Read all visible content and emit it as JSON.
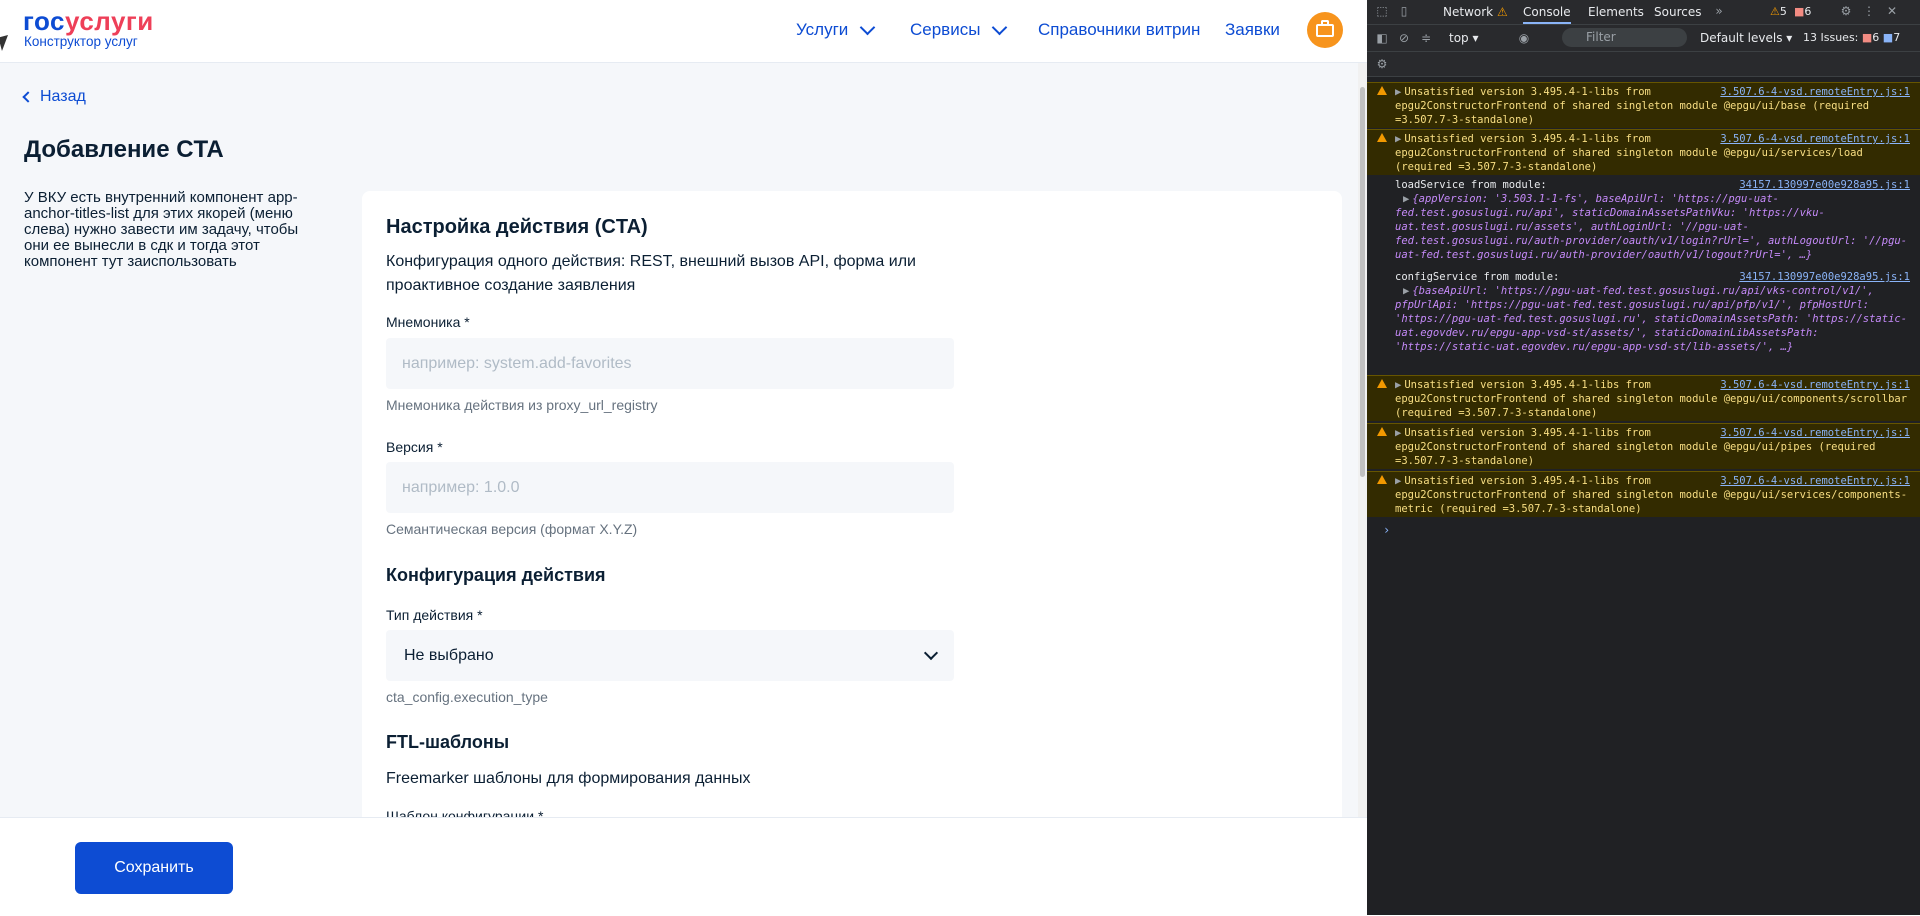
{
  "header": {
    "logo_part1": "гос",
    "logo_part2": "услуги",
    "logo_sub": "Конструктор услуг",
    "nav": [
      {
        "label": "Услуги",
        "has_dropdown": true
      },
      {
        "label": "Сервисы",
        "has_dropdown": true
      },
      {
        "label": "Справочники витрин",
        "has_dropdown": false
      },
      {
        "label": "Заявки",
        "has_dropdown": false
      }
    ],
    "avatar_color": "#f7941d"
  },
  "page": {
    "back_label": "Назад",
    "title": "Добавление CTA",
    "side_note": "У ВКУ есть внутренний компонент app-anchor-titles-list для этих якорей (меню слева) нужно завести им задачу, чтобы они ее вынесли в сдк и тогда этот компонент тут заиспользовать"
  },
  "form": {
    "section1_title": "Настройка действия (CTA)",
    "section1_desc": "Конфигурация одного действия: REST, внешний вызов API, форма или проактивное создание заявления",
    "mnemonic_label": "Мнемоника *",
    "mnemonic_placeholder": "например: system.add-favorites",
    "mnemonic_hint": "Мнемоника действия из proxy_url_registry",
    "version_label": "Версия *",
    "version_placeholder": "например: 1.0.0",
    "version_hint": "Семантическая версия (формат X.Y.Z)",
    "section2_title": "Конфигурация действия",
    "action_type_label": "Тип действия *",
    "action_type_value": "Не выбрано",
    "action_type_hint": "cta_config.execution_type",
    "section3_title": "FTL-шаблоны",
    "section3_desc": "Freemarker шаблоны для формирования данных",
    "template_label": "Шаблон конфигурации *"
  },
  "footer": {
    "save_label": "Сохранить"
  },
  "devtools": {
    "tabs": [
      "Network",
      "Console",
      "Elements",
      "Sources"
    ],
    "active_tab": "Console",
    "warn_count": "5",
    "error_count": "6",
    "context": "top",
    "filter_placeholder": "Filter",
    "levels": "Default levels",
    "issues_label": "13 Issues:",
    "issues_err": "6",
    "issues_info": "7",
    "messages": [
      {
        "type": "warn",
        "text": "Unsatisfied version 3.495.4-1-libs from epgu2ConstructorFrontend of shared singleton module @epgu/ui/base (required =3.507.7-3-standalone)",
        "source": "3.507.6-4-vsd.remoteEntry.js:1"
      },
      {
        "type": "warn",
        "text": "Unsatisfied version 3.495.4-1-libs from epgu2ConstructorFrontend of shared singleton module @epgu/ui/services/load (required =3.507.7-3-standalone)",
        "source": "3.507.6-4-vsd.remoteEntry.js:1"
      },
      {
        "type": "log",
        "text": "loadService from module:",
        "source": "34157.130997e00e928a95.js:1",
        "object": "{appVersion: '3.503.1-1-fs', baseApiUrl: 'https://pgu-uat-fed.test.gosuslugi.ru/api', staticDomainAssetsPathVku: 'https://vku-uat.test.gosuslugi.ru/assets', authLoginUrl: '//pgu-uat-fed.test.gosuslugi.ru/auth-provider/oauth/v1/login?rUrl=', authLogoutUrl: '//pgu-uat-fed.test.gosuslugi.ru/auth-provider/oauth/v1/logout?rUrl=', …}"
      },
      {
        "type": "log",
        "text": "configService from module:",
        "source": "34157.130997e00e928a95.js:1",
        "object": "{baseApiUrl: 'https://pgu-uat-fed.test.gosuslugi.ru/api/vks-control/v1/', pfpUrlApi: 'https://pgu-uat-fed.test.gosuslugi.ru/api/pfp/v1/', pfpHostUrl: 'https://pgu-uat-fed.test.gosuslugi.ru', staticDomainAssetsPath: 'https://static-uat.egovdev.ru/epgu-app-vsd-st/assets/', staticDomainLibAssetsPath: 'https://static-uat.egovdev.ru/epgu-app-vsd-st/lib-assets/', …}"
      },
      {
        "type": "warn",
        "text": "Unsatisfied version 3.495.4-1-libs from epgu2ConstructorFrontend of shared singleton module @epgu/ui/components/scrollbar (required =3.507.7-3-standalone)",
        "source": "3.507.6-4-vsd.remoteEntry.js:1"
      },
      {
        "type": "warn",
        "text": "Unsatisfied version 3.495.4-1-libs from epgu2ConstructorFrontend of shared singleton module @epgu/ui/pipes (required =3.507.7-3-standalone)",
        "source": "3.507.6-4-vsd.remoteEntry.js:1"
      },
      {
        "type": "warn",
        "text": "Unsatisfied version 3.495.4-1-libs from epgu2ConstructorFrontend of shared singleton module @epgu/ui/services/components-metric (required =3.507.7-3-standalone)",
        "source": "3.507.6-4-vsd.remoteEntry.js:1"
      }
    ]
  }
}
